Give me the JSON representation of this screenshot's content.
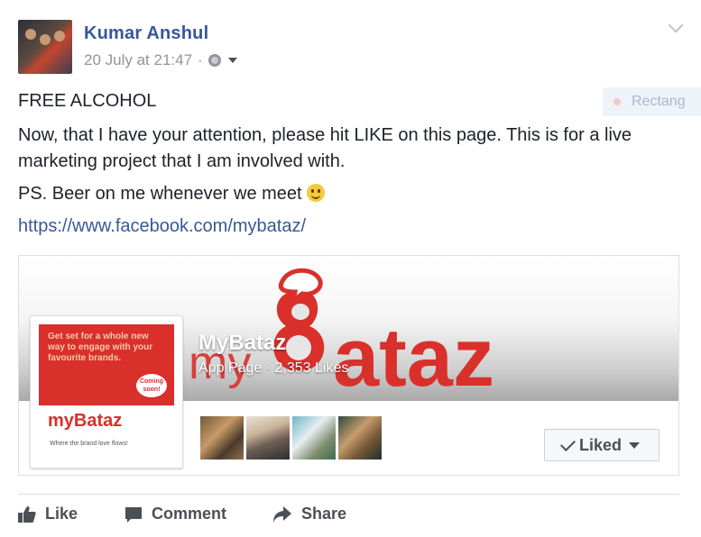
{
  "post": {
    "author": "Kumar Anshul",
    "timestamp": "20 July at 21:47",
    "separator": "·",
    "privacy_icon": "globe-icon",
    "lines": [
      "FREE ALCOHOL",
      "Now, that I have your attention, please hit LIKE on this page. This is for a live",
      "marketing project that I am involved with.",
      "PS. Beer on me whenever we meet"
    ],
    "link": "https://www.facebook.com/mybataz/"
  },
  "ghost_overlay": {
    "label": "Rectang"
  },
  "attachment": {
    "page_name": "MyBataz",
    "page_type": "App Page",
    "dot": "·",
    "likes": "2,353 Likes",
    "cover_logo_text": "myBataz",
    "profile_text": "Get set for a whole new way to engage with your favourite brands.",
    "profile_bubble": "Coming soon!",
    "profile_logo": "myBataz",
    "profile_tag": "Where the brand love flows!",
    "liked_button": "Liked"
  },
  "actions": {
    "like": "Like",
    "comment": "Comment",
    "share": "Share"
  },
  "colors": {
    "author_blue": "#365899",
    "link_blue": "#385898",
    "brand_red": "#d9302c",
    "text": "#1d2129",
    "muted": "#90949c"
  }
}
